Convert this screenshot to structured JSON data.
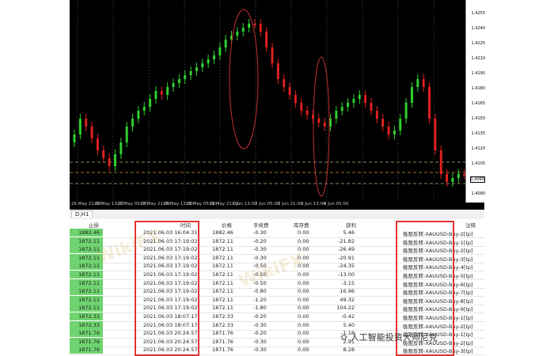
{
  "price_axis": [
    "1.4255",
    "1.4240",
    "1.4225",
    "1.4210",
    "1.4195",
    "1.4180",
    "1.4165",
    "1.4150",
    "1.4135",
    "1.4120",
    "1.4105",
    "1.4095",
    "1.4090"
  ],
  "price_marker": "1.4095",
  "time_axis": [
    "26 May 21:00",
    "26 May 13:00",
    "27 May 05:00",
    "27 May 21:00",
    "28 May 13:00",
    "31 May 05:00",
    "31 May 21:00",
    "1 Jun 13:00",
    "2 Jun 05:00",
    "2 Jun 21:00",
    "3 Jun 13:00",
    "4 Jun 05:00"
  ],
  "tab": {
    "label": "D,H1"
  },
  "table": {
    "headers": {
      "sl": "止损",
      "time": "时间",
      "price": "价格",
      "commission": "手续费",
      "swap": "库存费",
      "profit": "获利",
      "comment": "注释"
    },
    "rows": [
      {
        "sl": "1882.46",
        "time": "2021.06.03 16:04:31",
        "price": "1882.46",
        "commission": "-0.30",
        "swap": "0.00",
        "profit": "5.46",
        "comment": "极限反转-XAUUSD-Buy-2[tp]"
      },
      {
        "sl": "1872.11",
        "time": "2021.06.03 17:19:02",
        "price": "1872.11",
        "commission": "-0.20",
        "swap": "0.00",
        "profit": "-21.82",
        "comment": "极限反转-XAUUSD-Buy-1[tp]"
      },
      {
        "sl": "1872.11",
        "time": "2021.06.03 17:19:02",
        "price": "1872.11",
        "commission": "-0.30",
        "swap": "0.00",
        "profit": "-26.49",
        "comment": "极限反转-XAUUSD-Buy-2[tp]"
      },
      {
        "sl": "1872.11",
        "time": "2021.06.03 17:19:02",
        "price": "1872.11",
        "commission": "-0.30",
        "swap": "0.00",
        "profit": "-20.91",
        "comment": "极限反转-XAUUSD-Buy-3[tp]"
      },
      {
        "sl": "1872.11",
        "time": "2021.06.03 17:19:02",
        "price": "1872.11",
        "commission": "-0.50",
        "swap": "0.00",
        "profit": "-24.35",
        "comment": "极限反转-XAUUSD-Buy-4[tp]"
      },
      {
        "sl": "1872.11",
        "time": "2021.06.03 17:19:02",
        "price": "1872.11",
        "commission": "-0.50",
        "swap": "0.00",
        "profit": "-13.00",
        "comment": "极限反转-XAUUSD-Buy-5[tp]"
      },
      {
        "sl": "1872.11",
        "time": "2021.06.03 17:19:02",
        "price": "1872.11",
        "commission": "-0.50",
        "swap": "0.00",
        "profit": "-3.15",
        "comment": "极限反转-XAUUSD-Buy-6[tp]"
      },
      {
        "sl": "1872.11",
        "time": "2021.06.03 17:19:02",
        "price": "1872.11",
        "commission": "-0.80",
        "swap": "0.00",
        "profit": "16.96",
        "comment": "极限反转-XAUUSD-Buy-7[tp]"
      },
      {
        "sl": "1872.11",
        "time": "2021.06.03 17:19:02",
        "price": "1872.11",
        "commission": "-1.20",
        "swap": "0.00",
        "profit": "49.32",
        "comment": "极限反转-XAUUSD-Buy-8[tp]"
      },
      {
        "sl": "1872.11",
        "time": "2021.06.03 17:19:02",
        "price": "1872.11",
        "commission": "-1.80",
        "swap": "0.00",
        "profit": "104.22",
        "comment": "极限反转-XAUUSD-Buy-9[tp]"
      },
      {
        "sl": "1872.33",
        "time": "2021.06.03 18:07:17",
        "price": "1872.33",
        "commission": "-0.20",
        "swap": "0.00",
        "profit": "-0.42",
        "comment": "极限反转-XAUUSD-Buy-1[tp]"
      },
      {
        "sl": "1872.33",
        "time": "2021.06.03 18:07:17",
        "price": "1872.33",
        "commission": "-0.30",
        "swap": "0.00",
        "profit": "5.40",
        "comment": "极限反转-XAUUSD-Buy-2[tp]"
      },
      {
        "sl": "1871.76",
        "time": "2021.06.03 20:24:57",
        "price": "1871.76",
        "commission": "-0.20",
        "swap": "0.00",
        "profit": "-1.18",
        "comment": "极限反转-XAUUSD-Buy-1[tp]"
      },
      {
        "sl": "1871.76",
        "time": "2021.06.03 20:24:57",
        "price": "1871.76",
        "commission": "-0.30",
        "swap": "0.00",
        "profit": "2.91",
        "comment": "极限反转-XAUUSD-Buy-2[tp]"
      },
      {
        "sl": "1871.76",
        "time": "2021.06.03 20:24:57",
        "price": "1871.76",
        "commission": "-0.30",
        "swap": "0.00",
        "profit": "8.28",
        "comment": "极限反转-XAUUSD-Buy-3[tp]"
      }
    ]
  },
  "watermark_text": "人工智能投资大师尼克",
  "colors": {
    "bull": "#2fd02f",
    "bear": "#e02020",
    "sl_cell": "#6fd36f",
    "highlight": "#e03434"
  }
}
